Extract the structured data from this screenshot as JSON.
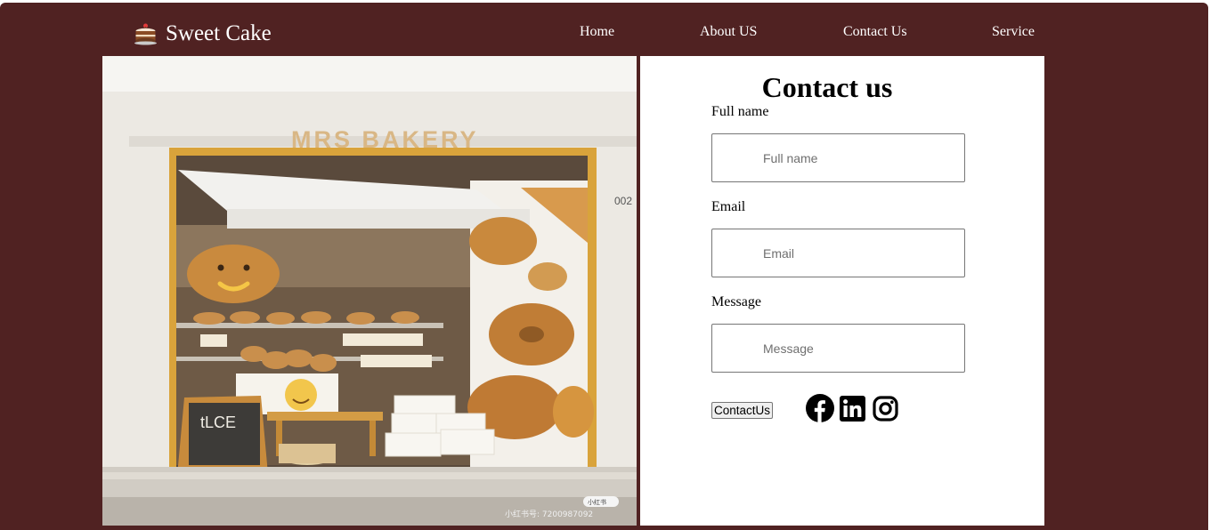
{
  "brand": {
    "name": "Sweet Cake",
    "icon": "cake-icon"
  },
  "nav": {
    "home": "Home",
    "about": "About US",
    "contact": "Contact Us",
    "service": "Service"
  },
  "hero": {
    "sign_text": "MRS BAKERY",
    "chalkboard_text": "tLCE",
    "watermark_brand": "小红书",
    "watermark_id": "小红书号: 7200987092",
    "side_number": "002"
  },
  "contact": {
    "title": "Contact us",
    "fullname_label": "Full name",
    "fullname_placeholder": "Full name",
    "email_label": "Email",
    "email_placeholder": "Email",
    "message_label": "Message",
    "message_placeholder": "Message",
    "submit_label": "ContactUs"
  },
  "social": [
    "facebook-icon",
    "linkedin-icon",
    "instagram-icon"
  ],
  "colors": {
    "header_bg": "#502222",
    "panel_bg": "#ffffff",
    "text": "#000000",
    "nav_text": "#ffffff"
  }
}
